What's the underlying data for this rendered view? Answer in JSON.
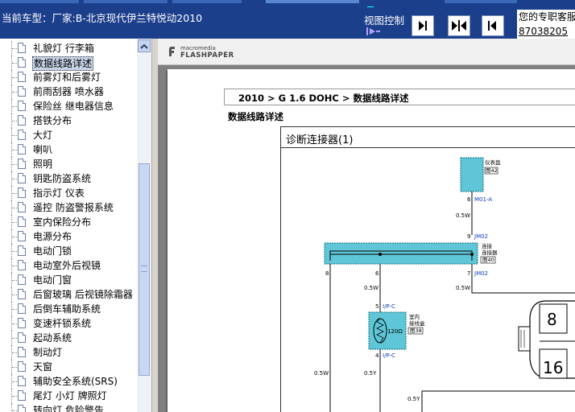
{
  "header": {
    "car_model": "当前车型：厂家:B-北京现代伊兰特悦动2010",
    "view_control": "视图控制",
    "right_title": "您的专职客服",
    "right_number": "87038205"
  },
  "toolbar": {
    "icons": [
      "prev-icon",
      "split-icon",
      "back-icon"
    ]
  },
  "tree": {
    "items": [
      {
        "label": "礼貌灯 行李箱",
        "selected": false
      },
      {
        "label": "数据线路详述",
        "selected": true
      },
      {
        "label": "前雾灯和后雾灯",
        "selected": false
      },
      {
        "label": "前雨刮器 喷水器",
        "selected": false
      },
      {
        "label": "保险丝 继电器信息",
        "selected": false
      },
      {
        "label": "搭铁分布",
        "selected": false
      },
      {
        "label": "大灯",
        "selected": false
      },
      {
        "label": "喇叭",
        "selected": false
      },
      {
        "label": "照明",
        "selected": false
      },
      {
        "label": "钥匙防盗系统",
        "selected": false
      },
      {
        "label": "指示灯 仪表",
        "selected": false
      },
      {
        "label": "遥控 防盗警报系统",
        "selected": false
      },
      {
        "label": "室内保险分布",
        "selected": false
      },
      {
        "label": "电源分布",
        "selected": false
      },
      {
        "label": "电动门锁",
        "selected": false
      },
      {
        "label": "电动室外后视镜",
        "selected": false
      },
      {
        "label": "电动门窗",
        "selected": false
      },
      {
        "label": "后窗玻璃 后视镜除霜器",
        "selected": false
      },
      {
        "label": "后倒车辅助系统",
        "selected": false
      },
      {
        "label": "变速杆锁系统",
        "selected": false
      },
      {
        "label": "起动系统",
        "selected": false
      },
      {
        "label": "制动灯",
        "selected": false
      },
      {
        "label": "天窗",
        "selected": false
      },
      {
        "label": "辅助安全系统(SRS)",
        "selected": false
      },
      {
        "label": "尾灯 小灯 牌照灯",
        "selected": false
      },
      {
        "label": "转向灯 危险警告",
        "selected": false
      }
    ]
  },
  "viewer": {
    "brand_top": "macromedia",
    "brand": "FLASHPAPER",
    "breadcrumb": "2010 > G 1.6 DOHC > 数据线路详述",
    "section_title": "数据线路详述",
    "diagram_title": "诊断连接器(1)"
  },
  "schematic": {
    "cluster_label": "仪表盘",
    "cluster_ref": "图42",
    "pin6": "6",
    "conn_m01": "M01-A",
    "wire_05w_a": "0.5W",
    "pin9": "9",
    "conn_jm02_top": "JM02",
    "junction_label": "连接",
    "junction_label2": "连接器",
    "junction_ref": "图40",
    "pin8": "8",
    "pin6b": "6",
    "pin7": "7",
    "conn_jm02_bot": "JM02",
    "wire_05w_b": "0.5W",
    "wire_05w_c": "0.5W",
    "pin5": "5",
    "conn_ipc_top": "I/P-C",
    "resistor": "120Ω",
    "room_label": "室内",
    "room_label2": "接线盒",
    "room_ref": "图38",
    "pin4": "4",
    "conn_ipc_bot": "I/P-C",
    "wire_05w_d": "0.5W",
    "wire_05y_a": "0.5Y",
    "wire_05y_b": "0.5Y",
    "obd_pin_a": "8",
    "obd_pin_b": "16"
  }
}
